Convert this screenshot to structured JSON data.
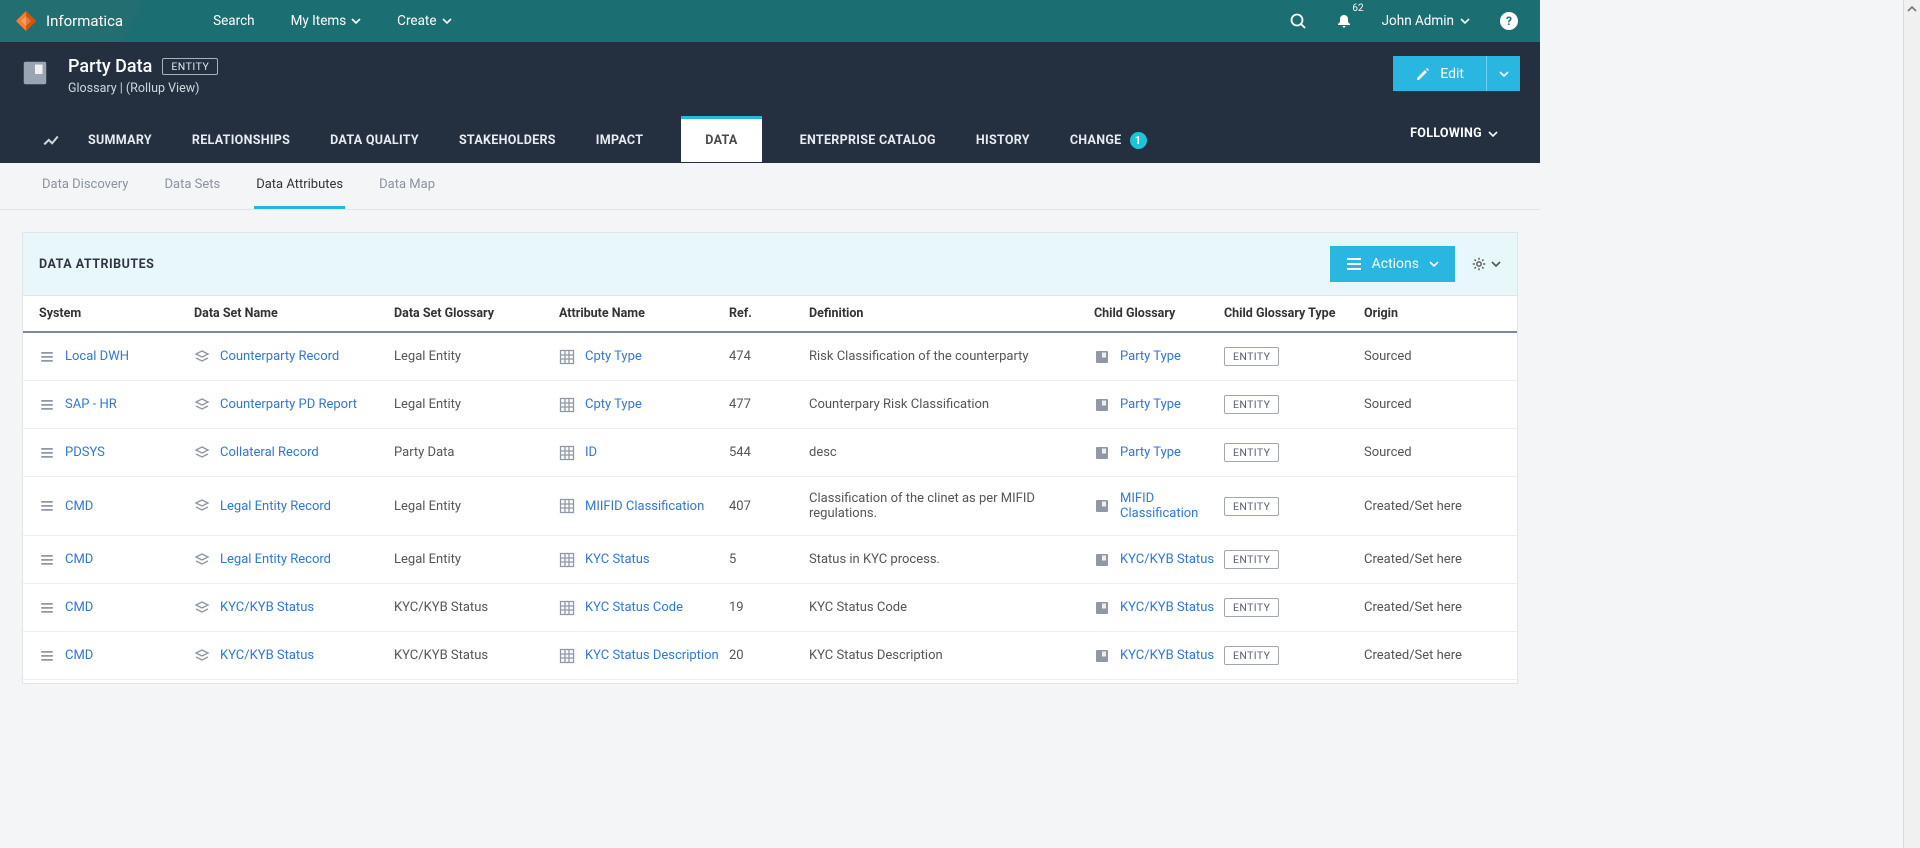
{
  "brand": {
    "name": "Informatica"
  },
  "topnav": {
    "search": "Search",
    "myitems": "My Items",
    "create": "Create"
  },
  "notifications": {
    "count": "62"
  },
  "user": {
    "name": "John Admin"
  },
  "header": {
    "title": "Party Data",
    "tag": "ENTITY",
    "subtitle": "Glossary | (Rollup View)",
    "edit": "Edit"
  },
  "tabs": [
    {
      "label": "SUMMARY"
    },
    {
      "label": "RELATIONSHIPS"
    },
    {
      "label": "DATA QUALITY"
    },
    {
      "label": "STAKEHOLDERS"
    },
    {
      "label": "IMPACT"
    },
    {
      "label": "DATA",
      "active": true
    },
    {
      "label": "ENTERPRISE CATALOG"
    },
    {
      "label": "HISTORY"
    },
    {
      "label": "CHANGE",
      "badge": "1"
    }
  ],
  "following": "FOLLOWING",
  "subtabs": [
    {
      "label": "Data Discovery"
    },
    {
      "label": "Data Sets"
    },
    {
      "label": "Data Attributes",
      "active": true
    },
    {
      "label": "Data Map"
    }
  ],
  "panel": {
    "title": "DATA ATTRIBUTES",
    "actions": "Actions"
  },
  "columns": {
    "system": "System",
    "dataset": "Data Set Name",
    "glossary": "Data Set Glossary",
    "attr": "Attribute Name",
    "ref": "Ref.",
    "def": "Definition",
    "cg": "Child Glossary",
    "cgt": "Child Glossary Type",
    "origin": "Origin"
  },
  "rows": [
    {
      "system": "Local DWH",
      "dataset": "Counterparty Record",
      "glossary": "Legal Entity",
      "attr": "Cpty Type",
      "ref": "474",
      "def": "Risk Classification of the counterparty",
      "cg": "Party Type",
      "cgt": "ENTITY",
      "origin": "Sourced"
    },
    {
      "system": "SAP - HR",
      "dataset": "Counterparty PD Report",
      "glossary": "Legal Entity",
      "attr": "Cpty Type",
      "ref": "477",
      "def": "Counterpary Risk Classification",
      "cg": "Party Type",
      "cgt": "ENTITY",
      "origin": "Sourced"
    },
    {
      "system": "PDSYS",
      "dataset": "Collateral Record",
      "glossary": "Party Data",
      "attr": "ID",
      "ref": "544",
      "def": "desc",
      "cg": "Party Type",
      "cgt": "ENTITY",
      "origin": "Sourced"
    },
    {
      "system": "CMD",
      "dataset": "Legal Entity Record",
      "glossary": "Legal Entity",
      "attr": "MIIFID Classification",
      "ref": "407",
      "def": "Classification of the clinet as per MIFID regulations.",
      "cg": "MIFID Classification",
      "cgt": "ENTITY",
      "origin": "Created/Set here"
    },
    {
      "system": "CMD",
      "dataset": "Legal Entity Record",
      "glossary": "Legal Entity",
      "attr": "KYC Status",
      "ref": "5",
      "def": "Status in KYC process.",
      "cg": "KYC/KYB Status",
      "cgt": "ENTITY",
      "origin": "Created/Set here"
    },
    {
      "system": "CMD",
      "dataset": "KYC/KYB Status",
      "glossary": "KYC/KYB Status",
      "attr": "KYC Status Code",
      "ref": "19",
      "def": "KYC Status Code",
      "cg": "KYC/KYB Status",
      "cgt": "ENTITY",
      "origin": "Created/Set here"
    },
    {
      "system": "CMD",
      "dataset": "KYC/KYB Status",
      "glossary": "KYC/KYB Status",
      "attr": "KYC Status Description",
      "ref": "20",
      "def": "KYC Status Description",
      "cg": "KYC/KYB Status",
      "cgt": "ENTITY",
      "origin": "Created/Set here"
    }
  ]
}
